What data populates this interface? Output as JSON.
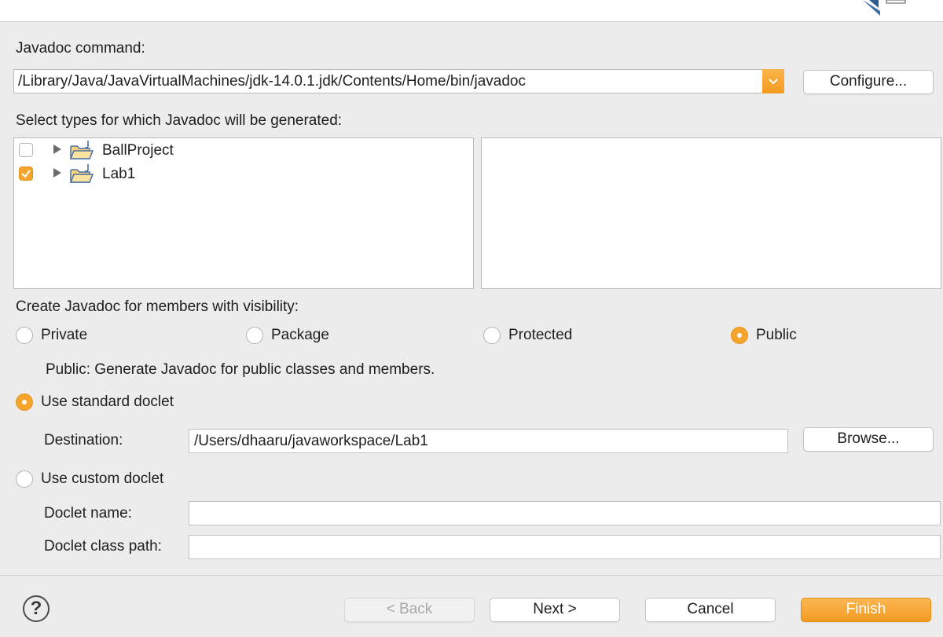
{
  "javadoc_command": {
    "label": "Javadoc command:",
    "value": "/Library/Java/JavaVirtualMachines/jdk-14.0.1.jdk/Contents/Home/bin/javadoc",
    "configure_label": "Configure..."
  },
  "types": {
    "label": "Select types for which Javadoc will be generated:",
    "projects": [
      {
        "name": "BallProject",
        "checked": false
      },
      {
        "name": "Lab1",
        "checked": true
      }
    ]
  },
  "visibility": {
    "label": "Create Javadoc for members with visibility:",
    "options": [
      "Private",
      "Package",
      "Protected",
      "Public"
    ],
    "selected": "Public",
    "description": "Public: Generate Javadoc for public classes and members."
  },
  "standard_doclet": {
    "label": "Use standard doclet",
    "selected": true,
    "destination_label": "Destination:",
    "destination_value": "/Users/dhaaru/javaworkspace/Lab1",
    "browse_label": "Browse..."
  },
  "custom_doclet": {
    "label": "Use custom doclet",
    "selected": false,
    "doclet_name_label": "Doclet name:",
    "doclet_name_value": "",
    "doclet_class_path_label": "Doclet class path:",
    "doclet_class_path_value": ""
  },
  "footer": {
    "help_symbol": "?",
    "back_label": "< Back",
    "next_label": "Next >",
    "cancel_label": "Cancel",
    "finish_label": "Finish"
  },
  "colors": {
    "accent": "#f5a52b",
    "accent_dark": "#e6931b"
  },
  "icons": [
    "chevron-down-icon",
    "expand-triangle-icon",
    "project-folder-icon",
    "help-icon",
    "wizard-banner-icon"
  ]
}
